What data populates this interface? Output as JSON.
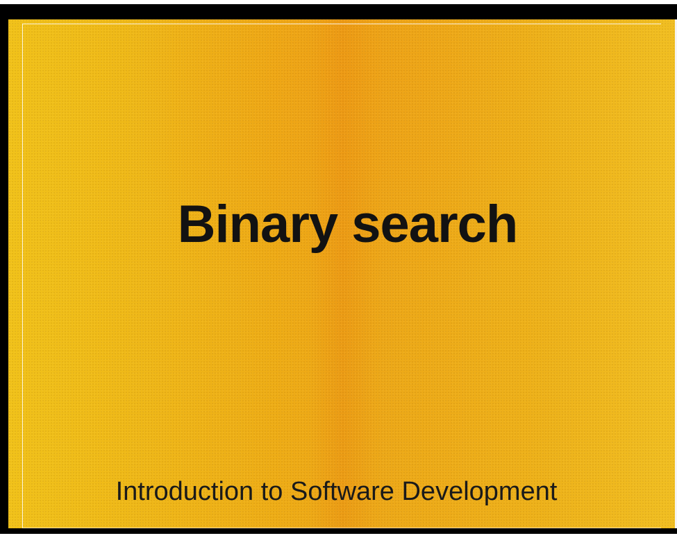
{
  "slide": {
    "title": "Binary search",
    "subtitle": "Introduction to Software Development"
  },
  "colors": {
    "background_left": "#f1c21a",
    "background_center": "#ec9c15",
    "background_right": "#f1bf22",
    "text": "#121212",
    "letterbox": "#000000"
  }
}
